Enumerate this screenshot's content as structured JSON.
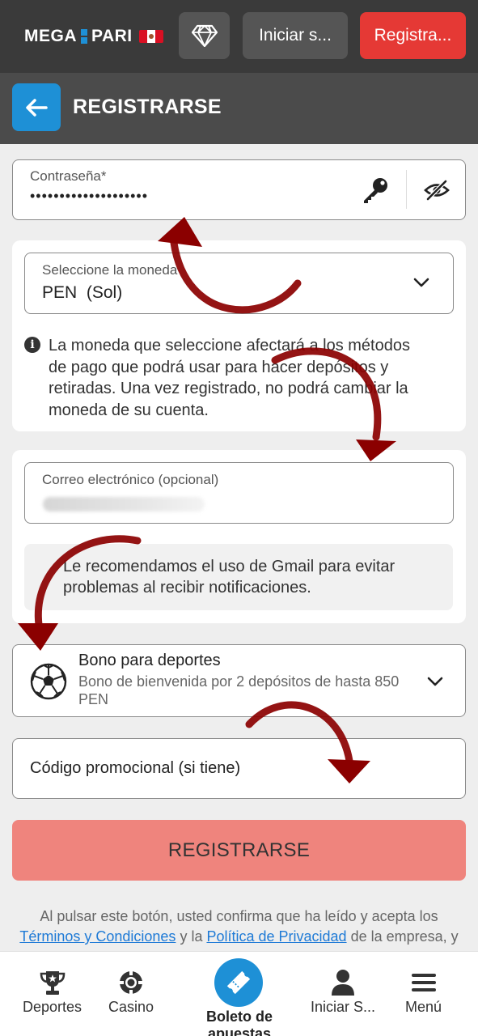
{
  "topbar": {
    "logo_left": "MEGA",
    "logo_right": "PARI",
    "login_label": "Iniciar s...",
    "register_label": "Registra..."
  },
  "header": {
    "title": "REGISTRARSE"
  },
  "password": {
    "label": "Contraseña*",
    "value": "••••••••••••••••••••"
  },
  "currency": {
    "label": "Seleccione la moneda",
    "code": "PEN",
    "name": "(Sol)",
    "info": "La moneda que seleccione afectará a los métodos de pago que podrá usar para hacer depósitos y retiradas. Una vez registrado, no podrá cambiar la moneda de su cuenta."
  },
  "email": {
    "label": "Correo electrónico (opcional)",
    "tip": "Le recomendamos el uso de Gmail para evitar problemas al recibir notificaciones."
  },
  "bonus": {
    "title": "Bono para deportes",
    "description": "Bono de bienvenida por 2 depósitos de hasta 850 PEN"
  },
  "promo": {
    "placeholder": "Código promocional (si tiene)"
  },
  "submit": {
    "label": "REGISTRARSE"
  },
  "legal": {
    "line1": "Al pulsar este botón, usted confirma que ha leído y acepta los",
    "terms_link": "Términos y Condiciones",
    "and": "y la",
    "privacy_link": "Política de Privacidad",
    "suffix": "de la empresa, y"
  },
  "nav": {
    "sports": "Deportes",
    "casino": "Casino",
    "betslip": "Boleto de apuestas",
    "login": "Iniciar S...",
    "menu": "Menú"
  },
  "colors": {
    "topbar": "#3a3a3a",
    "header": "#4b4b4b",
    "accent_blue": "#1e90d6",
    "register_red": "#e53935",
    "submit_pink": "#ef847d",
    "arrow_dark_red": "#8b0000"
  }
}
